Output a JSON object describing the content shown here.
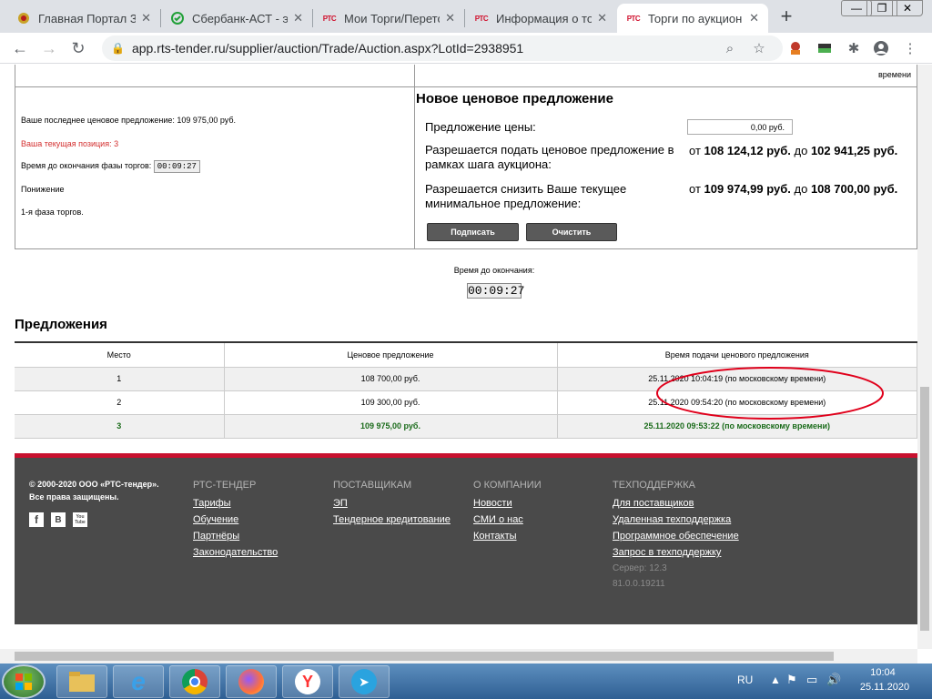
{
  "browser": {
    "tabs": [
      {
        "title": "Главная Портал За",
        "favicon": "emblem-icon"
      },
      {
        "title": "Сбербанк-АСТ - эл",
        "favicon": "sber-icon"
      },
      {
        "title": "Мои Торги/Перето",
        "favicon": "РТС"
      },
      {
        "title": "Информация о тор",
        "favicon": "РТС"
      },
      {
        "title": "Торги по аукцион",
        "favicon": "РТС",
        "active": true
      }
    ],
    "url": "app.rts-tender.ru/supplier/auction/Trade/Auction.aspx?LotId=2938951"
  },
  "trade": {
    "header_right": "времени",
    "last_offer": "Ваше последнее ценовое предложение: 109 975,00 руб.",
    "position": "Ваша текущая позиция: 3",
    "phase_time_label": "Время до окончания фазы торгов:",
    "phase_time": "00:09:27",
    "direction": "Понижение",
    "phase": "1-я фаза торгов.",
    "new_offer_title": "Новое ценовое предложение",
    "price_label": "Предложение цены:",
    "price_value": "0,00 руб.",
    "step_label": "Разрешается подать ценовое предложение в рамках шага аукциона:",
    "step_from_word": "от",
    "step_from": "108 124,12 руб.",
    "step_to_word": "до",
    "step_to": "102 941,25 руб.",
    "reduce_label": "Разрешается снизить Ваше текущее минимальное предложение:",
    "reduce_from_word": "от",
    "reduce_from": "109 974,99 руб.",
    "reduce_to_word": "до",
    "reduce_to": "108 700,00 руб.",
    "sign_button": "Подписать",
    "clear_button": "Очистить"
  },
  "countdown": {
    "label": "Время до окончания:",
    "value": "00:09:27"
  },
  "offers": {
    "title": "Предложения",
    "columns": [
      "Место",
      "Ценовое предложение",
      "Время подачи ценового предложения"
    ],
    "rows": [
      {
        "place": "1",
        "price": "108 700,00 руб.",
        "time": "25.11.2020 10:04:19 (по московскому времени)"
      },
      {
        "place": "2",
        "price": "109 300,00 руб.",
        "time": "25.11.2020 09:54:20 (по московскому времени)"
      },
      {
        "place": "3",
        "price": "109 975,00 руб.",
        "time": "25.11.2020 09:53:22 (по московскому времени)"
      }
    ],
    "highlight_color": "#e0001b"
  },
  "footer": {
    "copyright1": "© 2000-2020 ООО «РТС-тендер».",
    "copyright2": "Все права защищены.",
    "social": [
      "f",
      "В",
      "You Tube"
    ],
    "cols": [
      {
        "heading": "РТС-ТЕНДЕР",
        "links": [
          "Тарифы",
          "Обучение",
          "Партнёры",
          "Законодательство"
        ]
      },
      {
        "heading": "ПОСТАВЩИКАМ",
        "links": [
          "ЭП",
          "Тендерное кредитование"
        ]
      },
      {
        "heading": "О КОМПАНИИ",
        "links": [
          "Новости",
          "СМИ о нас",
          "Контакты"
        ]
      },
      {
        "heading": "ТЕХПОДДЕРЖКА",
        "links": [
          "Для поставщиков",
          "Удаленная техподдержка",
          "Программное обеспечение",
          "Запрос в техподдержку"
        ]
      }
    ],
    "server1": "Сервер: 12.3",
    "server2": "81.0.0.19211"
  },
  "taskbar": {
    "lang": "RU",
    "time": "10:04",
    "date": "25.11.2020"
  },
  "colors": {
    "accent": "#c8102e",
    "footer_bg": "#4a4a4a",
    "green": "#1a6b1a"
  }
}
